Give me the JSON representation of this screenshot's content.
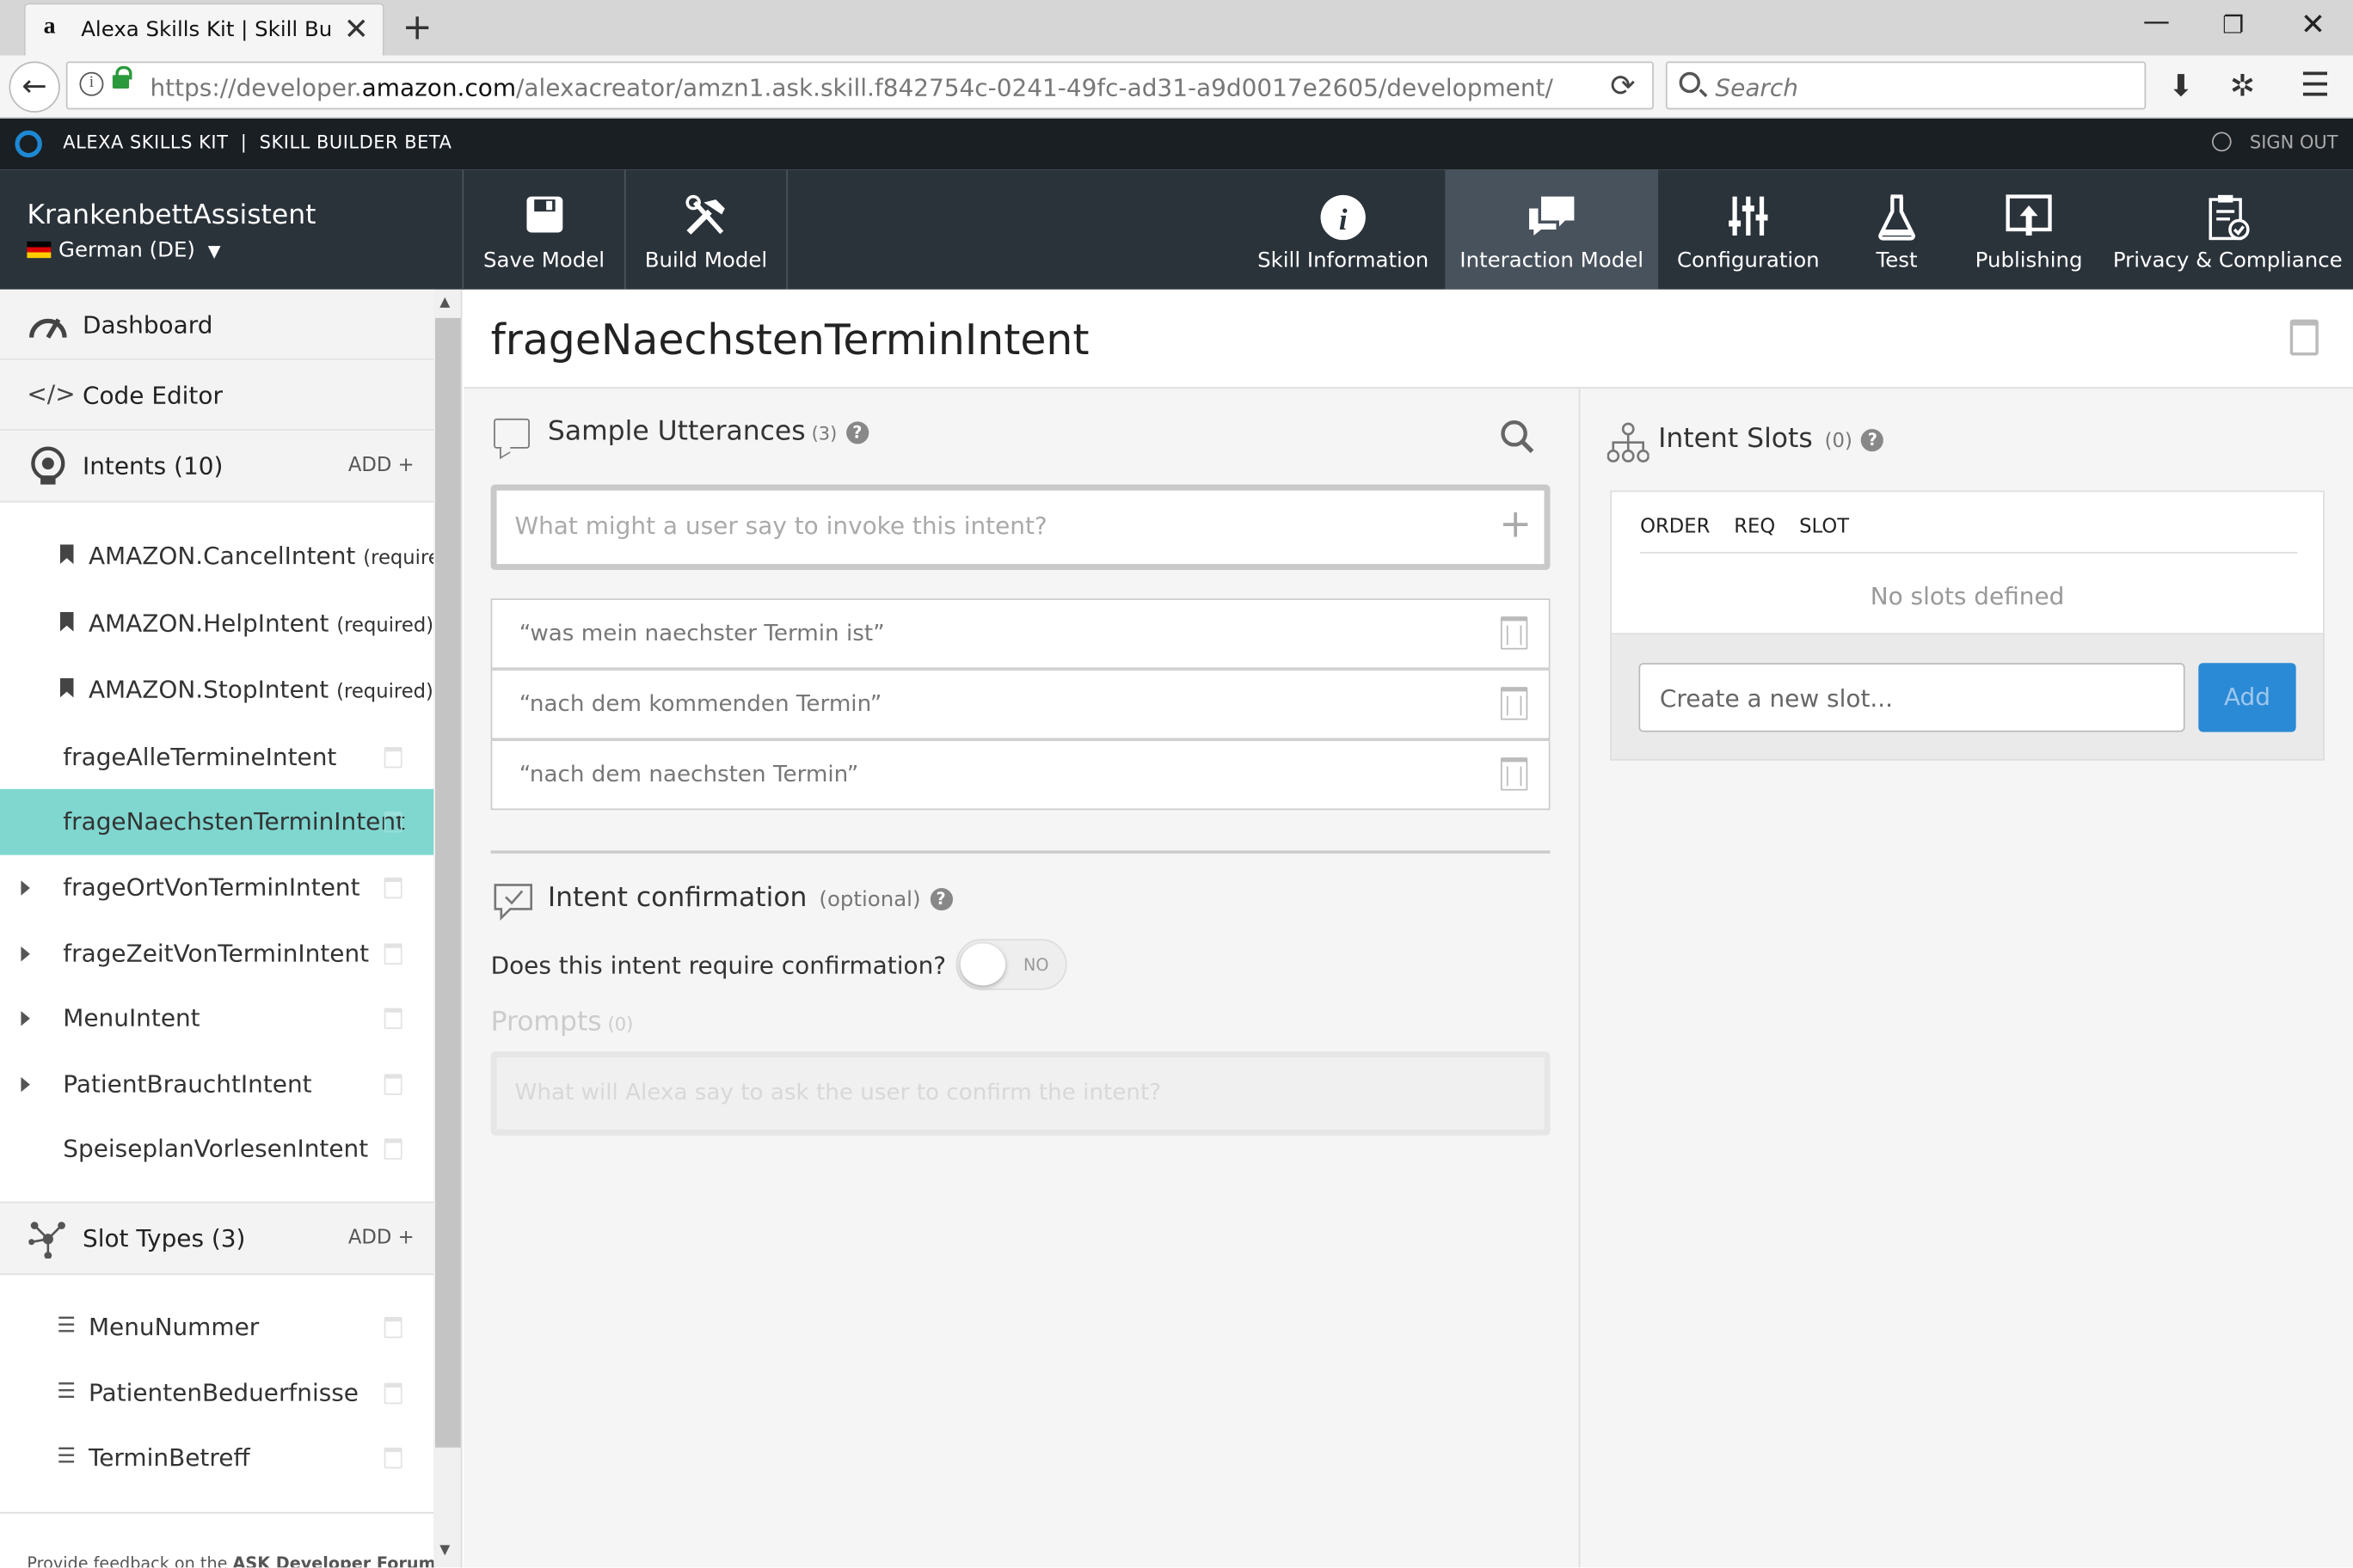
{
  "browser": {
    "tab_title": "Alexa Skills Kit | Skill Builder",
    "url_prefix": "https://developer.",
    "url_domain": "amazon.com",
    "url_suffix": "/alexacreator/amzn1.ask.skill.f842754c-0241-49fc-ad31-a9d0017e2605/development/de_DE/intent/frag",
    "search_placeholder": "Search",
    "icons": [
      "amazon-favicon",
      "close-icon",
      "plus-icon",
      "back-icon",
      "info-icon",
      "lock-icon",
      "reload-icon",
      "search-icon",
      "download-icon",
      "extension-icon",
      "menu-icon",
      "minimize-icon",
      "restore-icon",
      "close-window-icon"
    ]
  },
  "ask_header": {
    "brand": "ALEXA SKILLS KIT  |  SKILL BUILDER BETA",
    "sign_out": "SIGN OUT"
  },
  "topnav": {
    "skill_name": "KrankenbettAssistent",
    "locale": "German (DE)",
    "buttons": [
      {
        "label": "Save Model",
        "icon": "save-icon"
      },
      {
        "label": "Build Model",
        "icon": "build-tools-icon"
      },
      {
        "label": "Skill Information",
        "icon": "info-icon"
      },
      {
        "label": "Interaction Model",
        "icon": "chat-bubbles-icon",
        "active": true
      },
      {
        "label": "Configuration",
        "icon": "sliders-icon"
      },
      {
        "label": "Test",
        "icon": "flask-icon"
      },
      {
        "label": "Publishing",
        "icon": "publish-icon"
      },
      {
        "label": "Privacy & Compliance",
        "icon": "clipboard-check-icon"
      }
    ]
  },
  "sidebar": {
    "dashboard": "Dashboard",
    "code_editor": "Code Editor",
    "intents_header": "Intents (10)",
    "add_label": "ADD",
    "intents": [
      {
        "name": "AMAZON.CancelIntent",
        "note": "(required)"
      },
      {
        "name": "AMAZON.HelpIntent",
        "note": "(required)"
      },
      {
        "name": "AMAZON.StopIntent",
        "note": "(required)"
      },
      {
        "name": "frageAlleTermineIntent"
      },
      {
        "name": "frageNaechstenTerminIntent",
        "selected": true
      },
      {
        "name": "frageOrtVonTerminIntent"
      },
      {
        "name": "frageZeitVonTerminIntent"
      },
      {
        "name": "MenuIntent"
      },
      {
        "name": "PatientBrauchtIntent"
      },
      {
        "name": "SpeiseplanVorlesenIntent"
      }
    ],
    "slot_types_header": "Slot Types (3)",
    "slot_types": [
      "MenuNummer",
      "PatientenBeduerfnisse",
      "TerminBetreff"
    ],
    "feedback_prefix": "Provide feedback on the ",
    "feedback_link": "ASK Developer Forum"
  },
  "main": {
    "intent_title": "frageNaechstenTerminIntent",
    "utterances": {
      "title": "Sample Utterances",
      "count": "(3)",
      "placeholder": "What might a user say to invoke this intent?",
      "items": [
        "“was mein naechster Termin ist”",
        "“nach dem kommenden Termin”",
        "“nach dem naechsten Termin”"
      ]
    },
    "confirmation": {
      "title": "Intent confirmation",
      "optional": "(optional)",
      "question": "Does this intent require confirmation?",
      "toggle_state": "NO",
      "prompts_title": "Prompts",
      "prompts_count": "(0)",
      "prompt_placeholder": "What will Alexa say to ask the user to confirm the intent?"
    },
    "slots": {
      "title": "Intent Slots",
      "count": "(0)",
      "columns": [
        "ORDER",
        "REQ",
        "SLOT"
      ],
      "empty": "No slots defined",
      "new_placeholder": "Create a new slot...",
      "add_button": "Add"
    }
  },
  "colors": {
    "selected_intent": "#7fd7d0",
    "topnav_bg": "#2a323a",
    "active_nav": "#48525c",
    "add_button": "#2a8ad6"
  }
}
